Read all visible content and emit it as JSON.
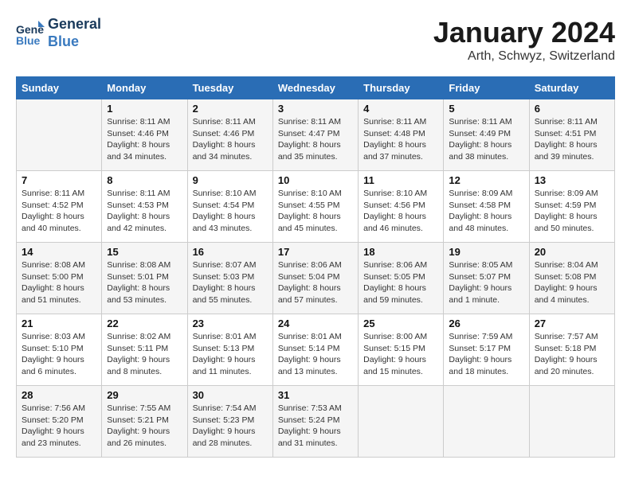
{
  "header": {
    "logo_line1": "General",
    "logo_line2": "Blue",
    "month_year": "January 2024",
    "location": "Arth, Schwyz, Switzerland"
  },
  "days_of_week": [
    "Sunday",
    "Monday",
    "Tuesday",
    "Wednesday",
    "Thursday",
    "Friday",
    "Saturday"
  ],
  "weeks": [
    [
      {
        "day": "",
        "info": ""
      },
      {
        "day": "1",
        "info": "Sunrise: 8:11 AM\nSunset: 4:46 PM\nDaylight: 8 hours\nand 34 minutes."
      },
      {
        "day": "2",
        "info": "Sunrise: 8:11 AM\nSunset: 4:46 PM\nDaylight: 8 hours\nand 34 minutes."
      },
      {
        "day": "3",
        "info": "Sunrise: 8:11 AM\nSunset: 4:47 PM\nDaylight: 8 hours\nand 35 minutes."
      },
      {
        "day": "4",
        "info": "Sunrise: 8:11 AM\nSunset: 4:48 PM\nDaylight: 8 hours\nand 37 minutes."
      },
      {
        "day": "5",
        "info": "Sunrise: 8:11 AM\nSunset: 4:49 PM\nDaylight: 8 hours\nand 38 minutes."
      },
      {
        "day": "6",
        "info": "Sunrise: 8:11 AM\nSunset: 4:51 PM\nDaylight: 8 hours\nand 39 minutes."
      }
    ],
    [
      {
        "day": "7",
        "info": "Sunrise: 8:11 AM\nSunset: 4:52 PM\nDaylight: 8 hours\nand 40 minutes."
      },
      {
        "day": "8",
        "info": "Sunrise: 8:11 AM\nSunset: 4:53 PM\nDaylight: 8 hours\nand 42 minutes."
      },
      {
        "day": "9",
        "info": "Sunrise: 8:10 AM\nSunset: 4:54 PM\nDaylight: 8 hours\nand 43 minutes."
      },
      {
        "day": "10",
        "info": "Sunrise: 8:10 AM\nSunset: 4:55 PM\nDaylight: 8 hours\nand 45 minutes."
      },
      {
        "day": "11",
        "info": "Sunrise: 8:10 AM\nSunset: 4:56 PM\nDaylight: 8 hours\nand 46 minutes."
      },
      {
        "day": "12",
        "info": "Sunrise: 8:09 AM\nSunset: 4:58 PM\nDaylight: 8 hours\nand 48 minutes."
      },
      {
        "day": "13",
        "info": "Sunrise: 8:09 AM\nSunset: 4:59 PM\nDaylight: 8 hours\nand 50 minutes."
      }
    ],
    [
      {
        "day": "14",
        "info": "Sunrise: 8:08 AM\nSunset: 5:00 PM\nDaylight: 8 hours\nand 51 minutes."
      },
      {
        "day": "15",
        "info": "Sunrise: 8:08 AM\nSunset: 5:01 PM\nDaylight: 8 hours\nand 53 minutes."
      },
      {
        "day": "16",
        "info": "Sunrise: 8:07 AM\nSunset: 5:03 PM\nDaylight: 8 hours\nand 55 minutes."
      },
      {
        "day": "17",
        "info": "Sunrise: 8:06 AM\nSunset: 5:04 PM\nDaylight: 8 hours\nand 57 minutes."
      },
      {
        "day": "18",
        "info": "Sunrise: 8:06 AM\nSunset: 5:05 PM\nDaylight: 8 hours\nand 59 minutes."
      },
      {
        "day": "19",
        "info": "Sunrise: 8:05 AM\nSunset: 5:07 PM\nDaylight: 9 hours\nand 1 minute."
      },
      {
        "day": "20",
        "info": "Sunrise: 8:04 AM\nSunset: 5:08 PM\nDaylight: 9 hours\nand 4 minutes."
      }
    ],
    [
      {
        "day": "21",
        "info": "Sunrise: 8:03 AM\nSunset: 5:10 PM\nDaylight: 9 hours\nand 6 minutes."
      },
      {
        "day": "22",
        "info": "Sunrise: 8:02 AM\nSunset: 5:11 PM\nDaylight: 9 hours\nand 8 minutes."
      },
      {
        "day": "23",
        "info": "Sunrise: 8:01 AM\nSunset: 5:13 PM\nDaylight: 9 hours\nand 11 minutes."
      },
      {
        "day": "24",
        "info": "Sunrise: 8:01 AM\nSunset: 5:14 PM\nDaylight: 9 hours\nand 13 minutes."
      },
      {
        "day": "25",
        "info": "Sunrise: 8:00 AM\nSunset: 5:15 PM\nDaylight: 9 hours\nand 15 minutes."
      },
      {
        "day": "26",
        "info": "Sunrise: 7:59 AM\nSunset: 5:17 PM\nDaylight: 9 hours\nand 18 minutes."
      },
      {
        "day": "27",
        "info": "Sunrise: 7:57 AM\nSunset: 5:18 PM\nDaylight: 9 hours\nand 20 minutes."
      }
    ],
    [
      {
        "day": "28",
        "info": "Sunrise: 7:56 AM\nSunset: 5:20 PM\nDaylight: 9 hours\nand 23 minutes."
      },
      {
        "day": "29",
        "info": "Sunrise: 7:55 AM\nSunset: 5:21 PM\nDaylight: 9 hours\nand 26 minutes."
      },
      {
        "day": "30",
        "info": "Sunrise: 7:54 AM\nSunset: 5:23 PM\nDaylight: 9 hours\nand 28 minutes."
      },
      {
        "day": "31",
        "info": "Sunrise: 7:53 AM\nSunset: 5:24 PM\nDaylight: 9 hours\nand 31 minutes."
      },
      {
        "day": "",
        "info": ""
      },
      {
        "day": "",
        "info": ""
      },
      {
        "day": "",
        "info": ""
      }
    ]
  ]
}
